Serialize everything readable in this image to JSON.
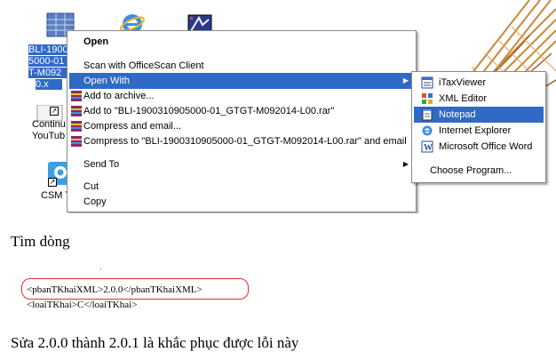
{
  "desktop": {
    "icons": [
      {
        "name": "file",
        "label_lines": [
          "BLI-1900",
          "5000-01",
          "T-M092",
          "0.x"
        ]
      },
      {
        "name": "continue",
        "label_lines": [
          "Continu",
          "YouTub"
        ]
      },
      {
        "name": "csm",
        "label_lines": [
          "CSM T"
        ]
      }
    ]
  },
  "context_menu": {
    "items": {
      "open": "Open",
      "scan": "Scan with OfficeScan Client",
      "open_with": "Open With",
      "add_archive": "Add to archive...",
      "add_rar": "Add to \"BLI-1900310905000-01_GTGT-M092014-L00.rar\"",
      "compress_email": "Compress and email...",
      "compress_rar_email": "Compress to \"BLI-1900310905000-01_GTGT-M092014-L00.rar\" and email",
      "send_to": "Send To",
      "cut": "Cut",
      "copy": "Copy"
    }
  },
  "open_with_submenu": {
    "items": {
      "itaxviewer": "iTaxViewer",
      "xml_editor": "XML Editor",
      "notepad": "Notepad",
      "ie": "Internet Explorer",
      "word": "Microsoft Office Word",
      "choose": "Choose Program..."
    }
  },
  "article": {
    "find_line": "Tìm dòng",
    "code_line_1": "<pbanTKhaiXML>2.0.0</pbanTKhaiXML>",
    "code_line_2": "<loaiTKhai>C</loaiTKhai>",
    "fix_line": "Sửa 2.0.0 thành 2.0.1 là khắc phục được lỗi này"
  },
  "colors": {
    "highlight": "#316ac5",
    "oval": "#d93030"
  }
}
